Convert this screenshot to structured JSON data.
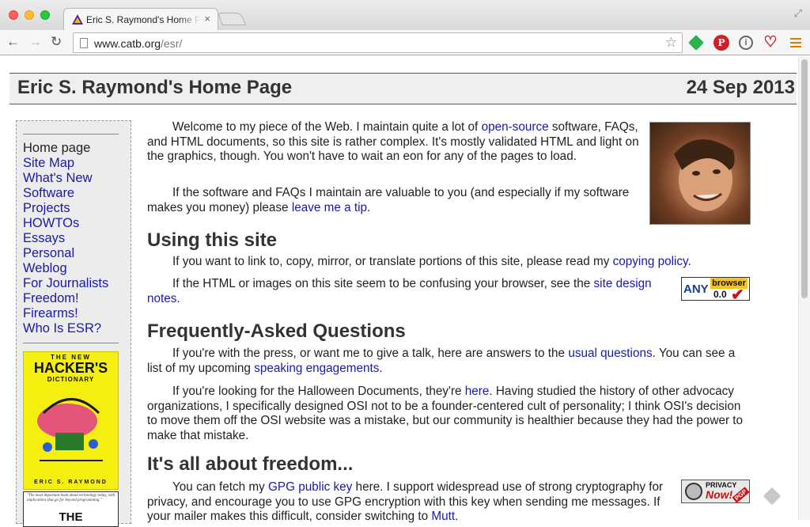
{
  "browser": {
    "tab_title": "Eric S. Raymond's Home Page",
    "tab_close": "×",
    "url_host": "www.catb.org",
    "url_path": "/esr/",
    "icons": [
      "back-icon",
      "forward-icon",
      "reload-icon",
      "star-icon",
      "feedly-icon",
      "pinterest-icon",
      "info-icon",
      "heart-icon",
      "menu-icon"
    ],
    "glyphs": {
      "back": "←",
      "forward": "→",
      "reload": "↻",
      "star": "☆",
      "fullscreen": "⤢",
      "pinterest": "P",
      "info": "i",
      "heart": "♡"
    }
  },
  "header": {
    "title": "Eric S. Raymond's Home Page",
    "date": "24 Sep 2013"
  },
  "sidebar": {
    "items": [
      {
        "label": "Home page"
      },
      {
        "label": "Site Map"
      },
      {
        "label": "What's New"
      },
      {
        "label": "Software"
      },
      {
        "label": "Projects"
      },
      {
        "label": "HOWTOs"
      },
      {
        "label": "Essays"
      },
      {
        "label": "Personal"
      },
      {
        "label": "Weblog"
      },
      {
        "label": "For Journalists"
      },
      {
        "label": "Freedom!"
      },
      {
        "label": "Firearms!"
      },
      {
        "label": "Who Is ESR?"
      }
    ],
    "book1": {
      "top": "THE NEW",
      "title": "HACKER'S",
      "subtitle": "DICTIONARY",
      "author": "ERIC S. RAYMOND"
    },
    "book2": {
      "quote": "\"The most important book about technology today, with implications that go far beyond programming.\"",
      "title": "THE CATHEDRAL"
    }
  },
  "content": {
    "intro": {
      "t1": "Welcome to my piece of the Web. I maintain quite a lot of ",
      "l1": "open-source",
      "t2": " software, FAQs, and HTML documents, so this site is rather complex. It's mostly validated HTML and light on the graphics, though. You won't have to wait an eon for any of the pages to load."
    },
    "tip": {
      "t1": "If the software and FAQs I maintain are valuable to you (and especially if my software makes you money) please ",
      "l1": "leave me a tip",
      "t2": "."
    },
    "using_heading": "Using this site",
    "using1": {
      "t1": "If you want to link to, copy, mirror, or translate portions of this site, please read my ",
      "l1": "copying policy",
      "t2": "."
    },
    "using2": {
      "t1": "If the HTML or images on this site seem to be confusing your browser, see the ",
      "l1": "site design notes",
      "t2": "."
    },
    "faq_heading": "Frequently-Asked Questions",
    "faq1": {
      "t1": "If you're with the press, or want me to give a talk, here are answers to the ",
      "l1": "usual questions",
      "t2": ". You can see a list of my upcoming ",
      "l2": "speaking engagements",
      "t3": "."
    },
    "faq2": {
      "t1": "If you're looking for the Halloween Documents, they're ",
      "l1": "here",
      "t2": ". Having studied the history of other advocacy organizations, I specifically designed OSI not to be a founder-centered cult of personality; I think OSI's decision to move them off the OSI website was a mistake, but our community is healthier because they had the power to make that mistake."
    },
    "freedom_heading": "It's all about freedom...",
    "freedom1": {
      "t1": "You can fetch my ",
      "l1": "GPG public key",
      "t2": " here. I support widespread use of strong cryptography for privacy, and encourage you to use GPG encryption with this key when sending me messages. If your mailer makes this difficult, consider switching to ",
      "l2": "Mutt",
      "t3": "."
    }
  },
  "badges": {
    "anybrowser": {
      "any": "ANY",
      "browser": "browser",
      "version": "0.0",
      "check": "✔"
    },
    "privacy": {
      "line1": "PRIVACY",
      "line2": "Now!",
      "pgp": "PGP"
    }
  },
  "colors": {
    "link": "#1a1aa6",
    "heading": "#333333",
    "book_yellow": "#f5ef10"
  }
}
